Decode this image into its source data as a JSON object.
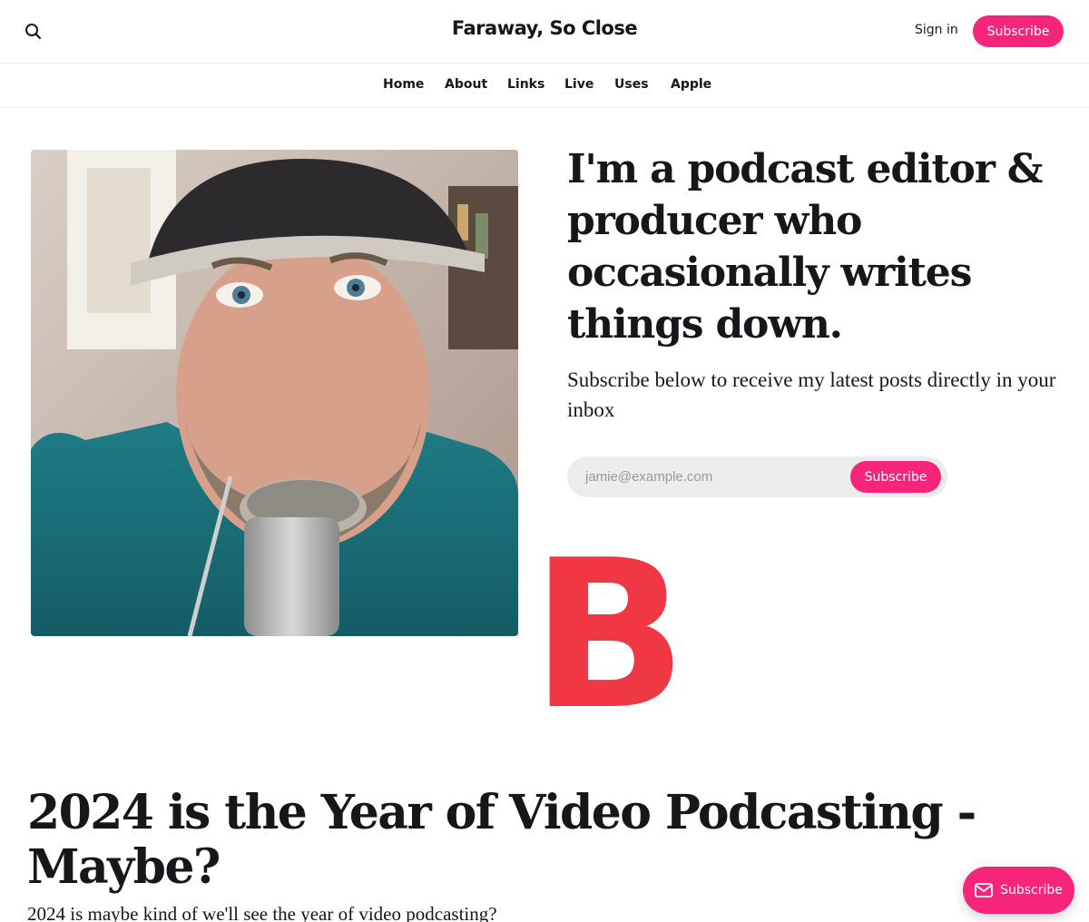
{
  "header": {
    "site_title": "Faraway, So Close",
    "sign_in_label": "Sign in",
    "subscribe_label": "Subscribe",
    "search_icon": "search-icon",
    "accent_color": "#f7257a"
  },
  "nav": {
    "items": [
      {
        "label": "Home"
      },
      {
        "label": "About"
      },
      {
        "label": "Links"
      },
      {
        "label": "Live"
      },
      {
        "label": "Uses"
      },
      {
        "label": "Apple"
      }
    ]
  },
  "hero": {
    "heading": "I'm a podcast editor & producer who occasionally writes things down.",
    "subheading": "Subscribe below to receive my latest posts directly in your inbox",
    "form": {
      "email_placeholder": "jamie@example.com",
      "email_value": "",
      "button_label": "Subscribe"
    }
  },
  "overlay": {
    "letter": "B",
    "color": "#f03845"
  },
  "post": {
    "title": "2024 is the Year of Video Podcasting - Maybe?",
    "excerpt": "2024 is maybe kind of we'll see the year of video podcasting?"
  },
  "portal": {
    "label": "Subscribe",
    "icon": "mail-icon"
  }
}
